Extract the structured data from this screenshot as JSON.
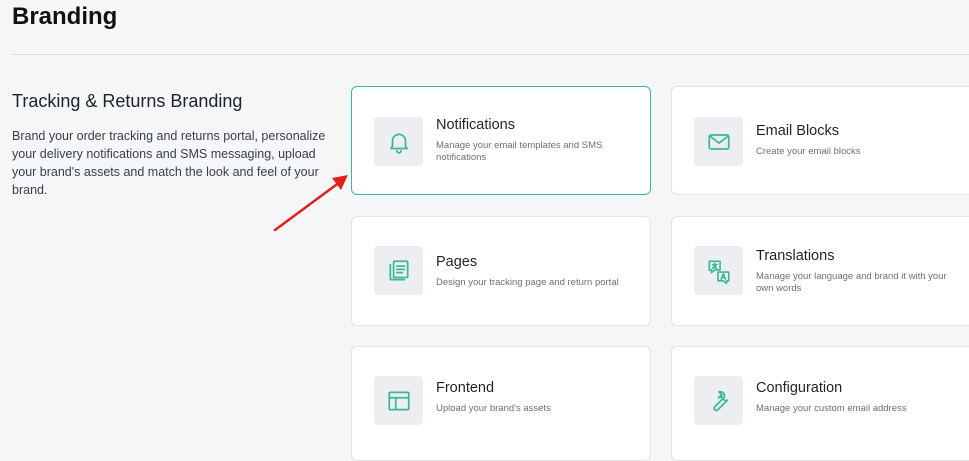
{
  "header": {
    "title": "Branding"
  },
  "section": {
    "title": "Tracking & Returns Branding",
    "description": "Brand your order tracking and returns portal, personalize your delivery notifications and SMS messaging, upload your brand's assets and match the look and feel of your brand."
  },
  "cards": [
    {
      "title": "Notifications",
      "description": "Manage your email templates and SMS notifications",
      "icon": "bell-icon"
    },
    {
      "title": "Email Blocks",
      "description": "Create your email blocks",
      "icon": "envelope-icon"
    },
    {
      "title": "Pages",
      "description": "Design your tracking page and return portal",
      "icon": "document-icon"
    },
    {
      "title": "Translations",
      "description": "Manage your language and brand it with your own words",
      "icon": "translate-icon"
    },
    {
      "title": "Frontend",
      "description": "Upload your brand's assets",
      "icon": "layout-icon"
    },
    {
      "title": "Configuration",
      "description": "Manage your custom email address",
      "icon": "wrench-icon"
    }
  ],
  "colors": {
    "accent": "#3bb89a",
    "arrow": "#e0201b",
    "background": "#f5f6f8"
  }
}
